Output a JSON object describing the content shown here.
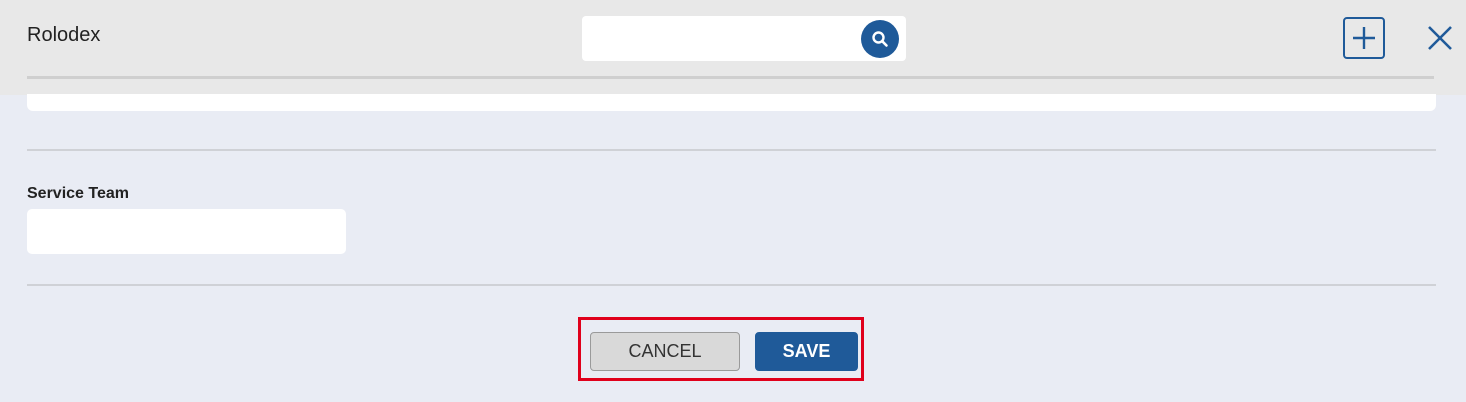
{
  "header": {
    "title": "Rolodex",
    "search": {
      "value": "",
      "placeholder": ""
    },
    "icons": {
      "search": "search-icon",
      "add": "plus-icon",
      "close": "close-icon"
    }
  },
  "form": {
    "service_team": {
      "label": "Service Team",
      "value": ""
    }
  },
  "actions": {
    "cancel_label": "CANCEL",
    "save_label": "SAVE"
  },
  "colors": {
    "accent": "#1f5a99",
    "highlight": "#e0001b",
    "header_bg": "#e8e8e8",
    "body_bg": "#e9ecf4"
  }
}
